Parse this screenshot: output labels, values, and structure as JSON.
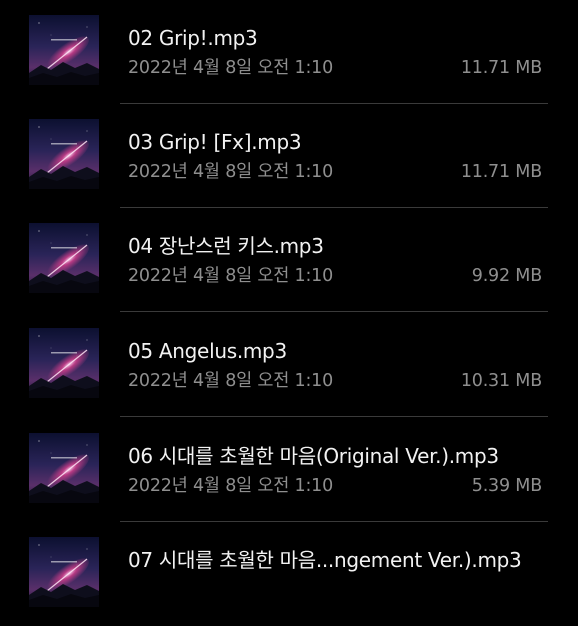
{
  "files": [
    {
      "name": "02 Grip!.mp3",
      "date": "2022년 4월 8일 오전 1:10",
      "size": "11.71 MB",
      "thumbnail_icon": "album-cover-thumbnail"
    },
    {
      "name": "03 Grip! [Fx].mp3",
      "date": "2022년 4월 8일 오전 1:10",
      "size": "11.71 MB",
      "thumbnail_icon": "album-cover-thumbnail"
    },
    {
      "name": "04 장난스런 키스.mp3",
      "date": "2022년 4월 8일 오전 1:10",
      "size": "9.92 MB",
      "thumbnail_icon": "album-cover-thumbnail"
    },
    {
      "name": "05 Angelus.mp3",
      "date": "2022년 4월 8일 오전 1:10",
      "size": "10.31 MB",
      "thumbnail_icon": "album-cover-thumbnail"
    },
    {
      "name": "06 시대를 초월한 마음(Original Ver.).mp3",
      "date": "2022년 4월 8일 오전 1:10",
      "size": "5.39 MB",
      "thumbnail_icon": "album-cover-thumbnail"
    },
    {
      "name": "07 시대를 초월한 마음...ngement Ver.).mp3",
      "date": "",
      "size": "",
      "thumbnail_icon": "album-cover-thumbnail"
    }
  ],
  "colors": {
    "background": "#000000",
    "title_text": "#f2f2f2",
    "meta_text": "#8f8f8f",
    "divider": "#3a3a3a",
    "thumbnail_sky": "#1a1f4a",
    "thumbnail_glow": "#e0408f"
  }
}
